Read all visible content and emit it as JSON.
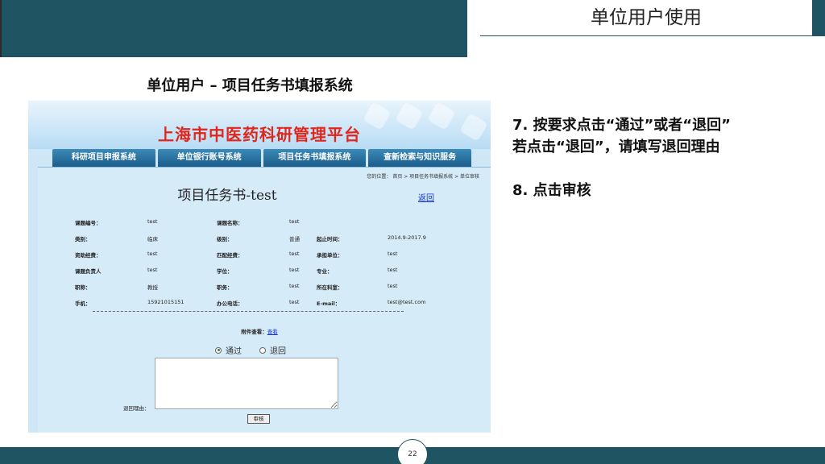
{
  "slide": {
    "title": "单位用户使用",
    "subtitle": "单位用户 – 项目任务书填报系统",
    "page_number": "22"
  },
  "screenshot": {
    "platform_title": "上海市中医药科研管理平台",
    "nav_tabs": [
      "科研项目申报系统",
      "单位银行账号系统",
      "项目任务书填报系统",
      "查新检索与知识服务"
    ],
    "breadcrumb": "您的位置： 首页 > 项目任务书填报系统 > 单位审核",
    "doc_title": "项目任务书-test",
    "return_link": "返回",
    "fields": {
      "code_label": "课题编号：",
      "code_value": "test",
      "name_label": "课题名称：",
      "name_value": "test",
      "category_label": "类别：",
      "category_value": "临床",
      "level_label": "级别：",
      "level_value": "普通",
      "period_label": "起止时间：",
      "period_value": "2014.9-2017.9",
      "funding_label": "资助经费：",
      "funding_value": "test",
      "matching_label": "匹配经费：",
      "matching_value": "test",
      "unit_label": "承担单位：",
      "unit_value": "test",
      "leader_label": "课题负责人",
      "leader_value": "test",
      "degree_label": "学位：",
      "degree_value": "test",
      "major_label": "专业：",
      "major_value": "test",
      "title_label": "职称：",
      "title_value": "教授",
      "position_label": "职务：",
      "position_value": "test",
      "dept_label": "所在科室：",
      "dept_value": "test",
      "mobile_label": "手机：",
      "mobile_value": "15921015151",
      "office_label": "办公电话：",
      "office_value": "test",
      "email_label": "E-mail：",
      "email_value": "test@test.com"
    },
    "attachment_label": "附件查看：",
    "attachment_link": "查看",
    "radio_pass": "通过",
    "radio_return": "退回",
    "reason_label": "退回理由：",
    "audit_button": "审核"
  },
  "steps": {
    "step7_line1": "7. 按要求点击“通过”或者“退回”",
    "step7_line2": "若点击“退回”，请填写退回理由",
    "step8": "8. 点击审核"
  },
  "colors": {
    "brand_dark": "#1f5462",
    "platform_red": "#e0261b",
    "nav_blue": "#1b5d8b",
    "page_bg": "#d6ebf8"
  }
}
